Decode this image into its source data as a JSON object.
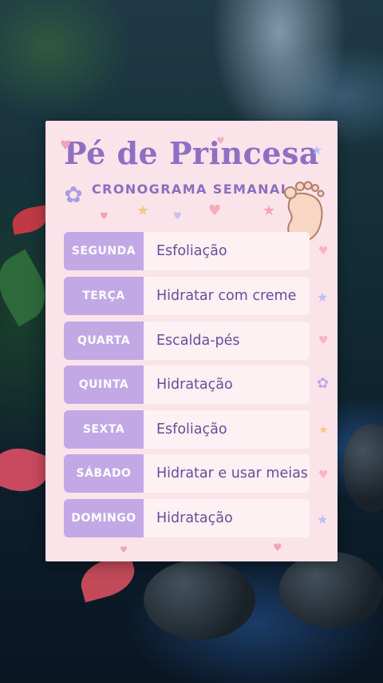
{
  "card": {
    "title": "Pé de Princesa",
    "subtitle": "CRONOGRAMA SEMANAL"
  },
  "schedule": [
    {
      "day": "SEGUNDA",
      "task": "Esfoliação"
    },
    {
      "day": "TERÇA",
      "task": "Hidratar com creme"
    },
    {
      "day": "QUARTA",
      "task": "Escalda-pés"
    },
    {
      "day": "QUINTA",
      "task": "Hidratação"
    },
    {
      "day": "SEXTA",
      "task": "Esfoliação"
    },
    {
      "day": "SÁBADO",
      "task": "Hidratar e usar meias"
    },
    {
      "day": "DOMINGO",
      "task": "Hidratação"
    }
  ],
  "colors": {
    "card_bg": "#fbe3ea",
    "title": "#8f6fc4",
    "day_pill": "#c3a8e6",
    "task_bg": "#fdf1f4",
    "task_text": "#6a4d9a"
  },
  "icons": [
    "flower-icon",
    "foot-icon",
    "heart-icon",
    "star-icon"
  ]
}
